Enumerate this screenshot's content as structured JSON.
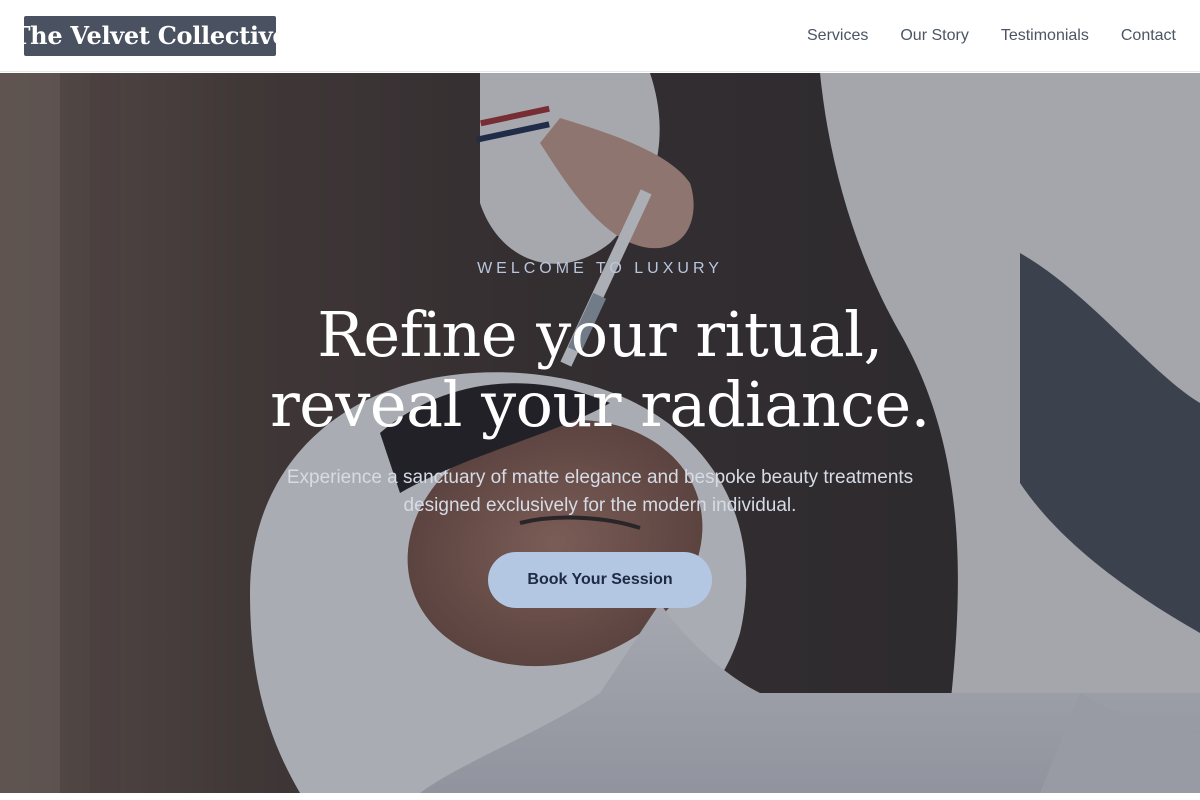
{
  "header": {
    "logo": "The Velvet Collective",
    "nav": [
      "Services",
      "Our Story",
      "Testimonials",
      "Contact"
    ]
  },
  "hero": {
    "eyebrow": "WELCOME TO LUXURY",
    "headline_line1": "Refine your ritual,",
    "headline_line2": "reveal your radiance.",
    "subtext": "Experience a sanctuary of matte elegance and bespoke beauty treatments designed exclusively for the modern individual.",
    "cta_label": "Book Your Session"
  },
  "colors": {
    "logo_bg": "#4a5160",
    "accent": "#b3c6e2",
    "cta_text": "#1f2a44",
    "eyebrow": "#b9c6dc"
  }
}
